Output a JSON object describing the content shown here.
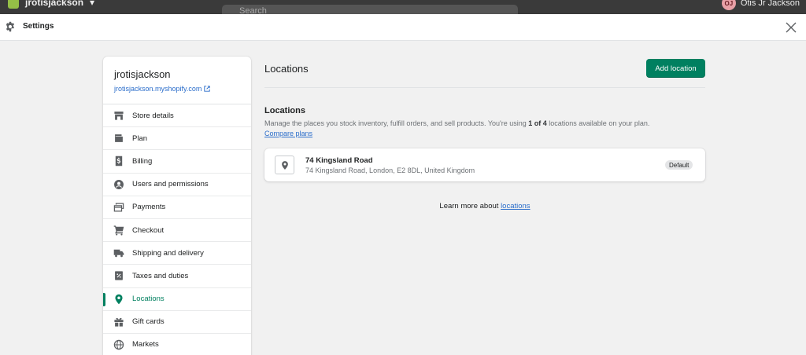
{
  "topbar": {
    "store_name": "jrotisjackson",
    "search_placeholder": "Search",
    "user_initials": "OJ",
    "user_name": "Otis Jr Jackson"
  },
  "header": {
    "title": "Settings"
  },
  "sidebar": {
    "store_name": "jrotisjackson",
    "store_url": "jrotisjackson.myshopify.com",
    "items": [
      {
        "label": "Store details",
        "icon": "store-icon"
      },
      {
        "label": "Plan",
        "icon": "wallet-icon"
      },
      {
        "label": "Billing",
        "icon": "dollar-icon"
      },
      {
        "label": "Users and permissions",
        "icon": "user-circle-icon"
      },
      {
        "label": "Payments",
        "icon": "payments-icon"
      },
      {
        "label": "Checkout",
        "icon": "cart-icon"
      },
      {
        "label": "Shipping and delivery",
        "icon": "truck-icon"
      },
      {
        "label": "Taxes and duties",
        "icon": "percent-icon"
      },
      {
        "label": "Locations",
        "icon": "location-pin-icon",
        "active": true
      },
      {
        "label": "Gift cards",
        "icon": "gift-icon"
      },
      {
        "label": "Markets",
        "icon": "globe-icon"
      }
    ]
  },
  "main": {
    "title": "Locations",
    "add_button": "Add location",
    "section_title": "Locations",
    "desc_part1": "Manage the places you stock inventory, fulfill orders, and sell products. You're using ",
    "desc_bold": "1 of 4",
    "desc_part2": " locations available on your plan. ",
    "compare_link": "Compare plans",
    "location": {
      "name": "74 Kingsland Road",
      "address": "74 Kingsland Road, London, E2 8DL, United Kingdom",
      "badge": "Default"
    },
    "learn_text": "Learn more about ",
    "learn_link": "locations"
  },
  "colors": {
    "accent": "#008060",
    "link": "#2c6ecb",
    "active_nav": "#007f5f"
  }
}
